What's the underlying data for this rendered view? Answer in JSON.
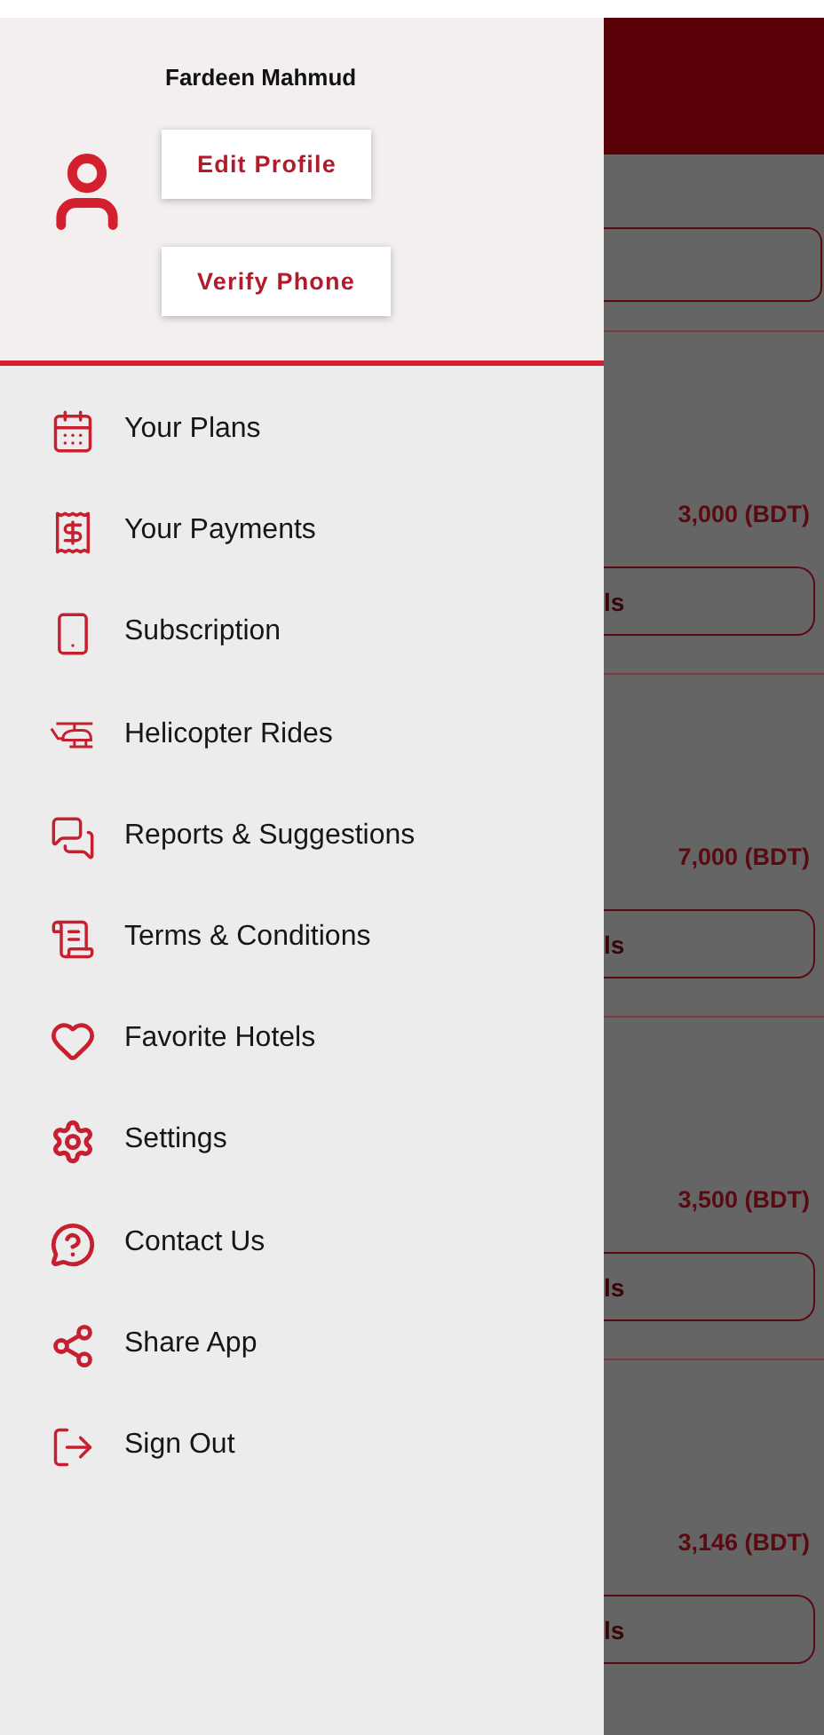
{
  "profile": {
    "name": "Fardeen Mahmud",
    "buttons": [
      "Edit Profile",
      "Verify Phone"
    ]
  },
  "menu": [
    {
      "label": "Your Plans"
    },
    {
      "label": "Your Payments"
    },
    {
      "label": "Subscription"
    },
    {
      "label": "Helicopter Rides"
    },
    {
      "label": "Reports & Suggestions"
    },
    {
      "label": "Terms & Conditions"
    },
    {
      "label": "Favorite Hotels"
    },
    {
      "label": "Settings"
    },
    {
      "label": "Contact Us"
    },
    {
      "label": "Share App"
    },
    {
      "label": "Sign Out"
    }
  ],
  "hotel_cards": [
    {
      "price": "3,000 (BDT)",
      "button": "ls"
    },
    {
      "price": "7,000 (BDT)",
      "button": "ls"
    },
    {
      "price": "3,500 (BDT)",
      "button": "ls"
    },
    {
      "price": "3,146 (BDT)",
      "button": "ls"
    }
  ]
}
